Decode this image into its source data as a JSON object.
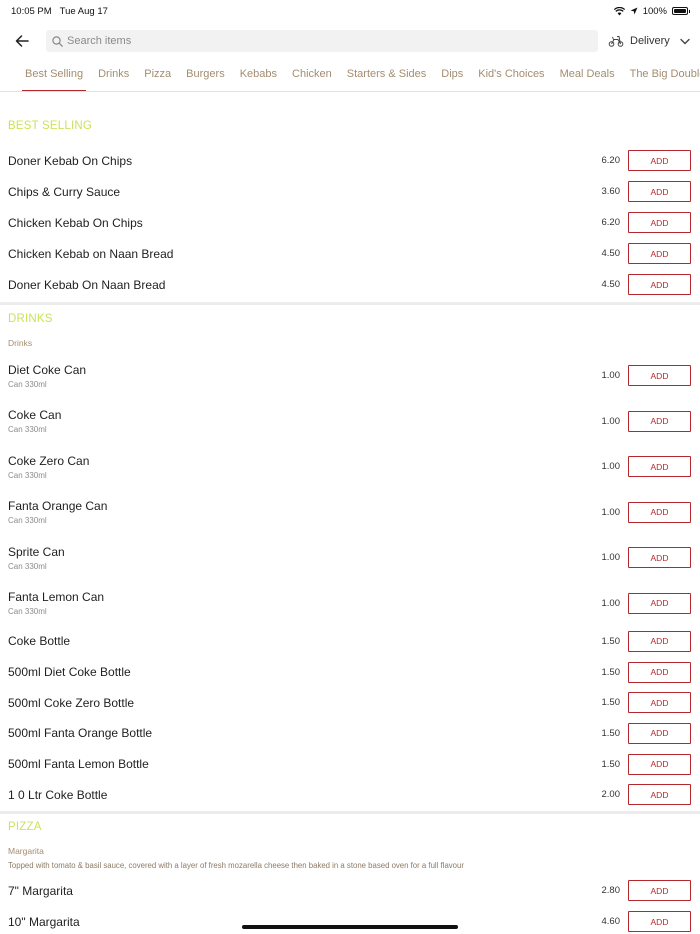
{
  "status": {
    "time": "10:05 PM",
    "date": "Tue Aug 17",
    "battery": "100%",
    "battery_level": 1.0
  },
  "search": {
    "placeholder": "Search items"
  },
  "delivery": {
    "label": "Delivery"
  },
  "tabs": [
    "Best Selling",
    "Drinks",
    "Pizza",
    "Burgers",
    "Kebabs",
    "Chicken",
    "Starters & Sides",
    "Dips",
    "Kid's Choices",
    "Meal Deals",
    "The Big Double"
  ],
  "add_label": "ADD",
  "sections": [
    {
      "title": "BEST SELLING",
      "items": [
        {
          "name": "Doner Kebab On Chips",
          "price": "6.20"
        },
        {
          "name": "Chips & Curry Sauce",
          "price": "3.60"
        },
        {
          "name": "Chicken Kebab On Chips",
          "price": "6.20"
        },
        {
          "name": "Chicken Kebab on Naan Bread",
          "price": "4.50"
        },
        {
          "name": "Doner Kebab On Naan Bread",
          "price": "4.50"
        }
      ]
    },
    {
      "title": "DRINKS",
      "subtitle": "Drinks",
      "items": [
        {
          "name": "Diet Coke Can",
          "desc": "Can 330ml",
          "price": "1.00"
        },
        {
          "name": "Coke Can",
          "desc": "Can 330ml",
          "price": "1.00"
        },
        {
          "name": "Coke Zero Can",
          "desc": "Can 330ml",
          "price": "1.00"
        },
        {
          "name": "Fanta Orange Can",
          "desc": "Can 330ml",
          "price": "1.00"
        },
        {
          "name": "Sprite Can",
          "desc": "Can 330ml",
          "price": "1.00"
        },
        {
          "name": "Fanta Lemon Can",
          "desc": "Can 330ml",
          "price": "1.00"
        },
        {
          "name": "Coke Bottle",
          "price": "1.50"
        },
        {
          "name": "500ml Diet Coke Bottle",
          "price": "1.50"
        },
        {
          "name": "500ml Coke Zero Bottle",
          "price": "1.50"
        },
        {
          "name": "500ml Fanta Orange Bottle",
          "price": "1.50"
        },
        {
          "name": "500ml Fanta Lemon Bottle",
          "price": "1.50"
        },
        {
          "name": "1 0 Ltr Coke Bottle",
          "price": "2.00"
        }
      ]
    },
    {
      "title": "PIZZA",
      "subtitle": "Margarita",
      "description": "Topped with tomato & basil sauce, covered with a layer of fresh mozarella cheese then baked in a stone based oven for a full flavour",
      "items": [
        {
          "name": "7\" Margarita",
          "price": "2.80"
        },
        {
          "name": "10\" Margarita",
          "price": "4.60"
        }
      ]
    }
  ]
}
